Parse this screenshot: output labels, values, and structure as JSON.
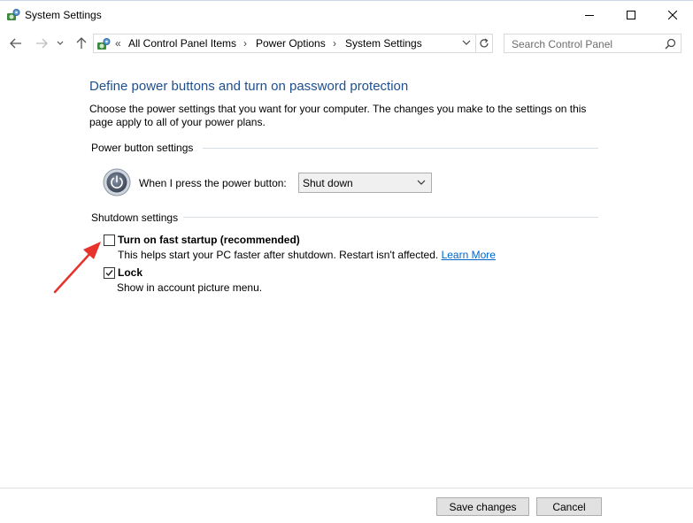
{
  "window": {
    "title": "System Settings"
  },
  "nav": {
    "overflow_marker": "«",
    "breadcrumbs": [
      "All Control Panel Items",
      "Power Options",
      "System Settings"
    ],
    "separator": "›",
    "search_placeholder": "Search Control Panel"
  },
  "content": {
    "title": "Define power buttons and turn on password protection",
    "description": "Choose the power settings that you want for your computer. The changes you make to the settings on this page apply to all of your power plans.",
    "power_group": {
      "label": "Power button settings",
      "power_button_label": "When I press the power button:",
      "power_button_value": "Shut down"
    },
    "shutdown_group": {
      "label": "Shutdown settings",
      "fast_startup": {
        "label": "Turn on fast startup (recommended)",
        "description": "This helps start your PC faster after shutdown. Restart isn't affected.",
        "link": "Learn More",
        "checked": false
      },
      "lock": {
        "label": "Lock",
        "description": "Show in account picture menu.",
        "checked": true
      }
    }
  },
  "footer": {
    "save_label": "Save changes",
    "cancel_label": "Cancel"
  },
  "colors": {
    "title_blue": "#1e4f91",
    "link_blue": "#0066cc",
    "annotation_red": "#e8322c"
  }
}
